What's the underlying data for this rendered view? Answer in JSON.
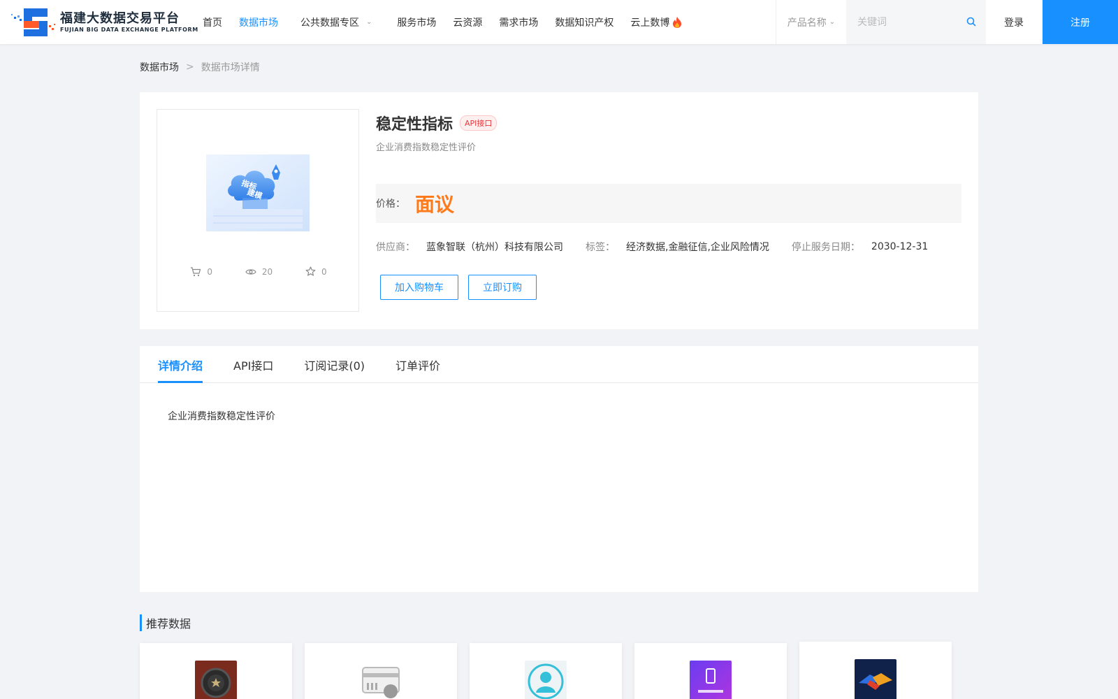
{
  "header": {
    "logo_cn": "福建大数据交易平台",
    "logo_en": "FUJIAN BIG DATA EXCHANGE  PLATFORM",
    "nav": [
      {
        "label": "首页",
        "active": false
      },
      {
        "label": "数据市场",
        "active": true
      },
      {
        "label": "公共数据专区",
        "active": false
      },
      {
        "label": "服务市场",
        "active": false
      },
      {
        "label": "云资源",
        "active": false
      },
      {
        "label": "需求市场",
        "active": false
      },
      {
        "label": "数据知识产权",
        "active": false
      },
      {
        "label": "云上数博",
        "active": false
      }
    ],
    "search_select": "产品名称",
    "search_placeholder": "关键词",
    "login": "登录",
    "register": "注册",
    "accent_color": "#1890ff"
  },
  "breadcrumb": {
    "root": "数据市场",
    "separator": ">",
    "current": "数据市场详情"
  },
  "product": {
    "title": "稳定性指标",
    "badge": "API接口",
    "subtitle": "企业消费指数稳定性评价",
    "image_text_1": "指标",
    "image_text_2": "建模",
    "stats": {
      "cart": "0",
      "views": "20",
      "favorites": "0"
    },
    "price_label": "价格：",
    "price_value": "面议",
    "supplier_label": "供应商：",
    "supplier": "蓝象智联（杭州）科技有限公司",
    "tags_label": "标签：",
    "tags": "经济数据,金融征信,企业风险情况",
    "stop_label": "停止服务日期：",
    "stop_date": "2030-12-31",
    "add_cart": "加入购物车",
    "buy_now": "立即订购",
    "price_color": "#ff7a1a"
  },
  "tabs": [
    {
      "label": "详情介绍",
      "active": true
    },
    {
      "label": "API接口",
      "active": false
    },
    {
      "label": "订阅记录(0)",
      "active": false
    },
    {
      "label": "订单评价",
      "active": false
    }
  ],
  "detail_text": "企业消费指数稳定性评价",
  "recommend": {
    "title": "推荐数据"
  }
}
